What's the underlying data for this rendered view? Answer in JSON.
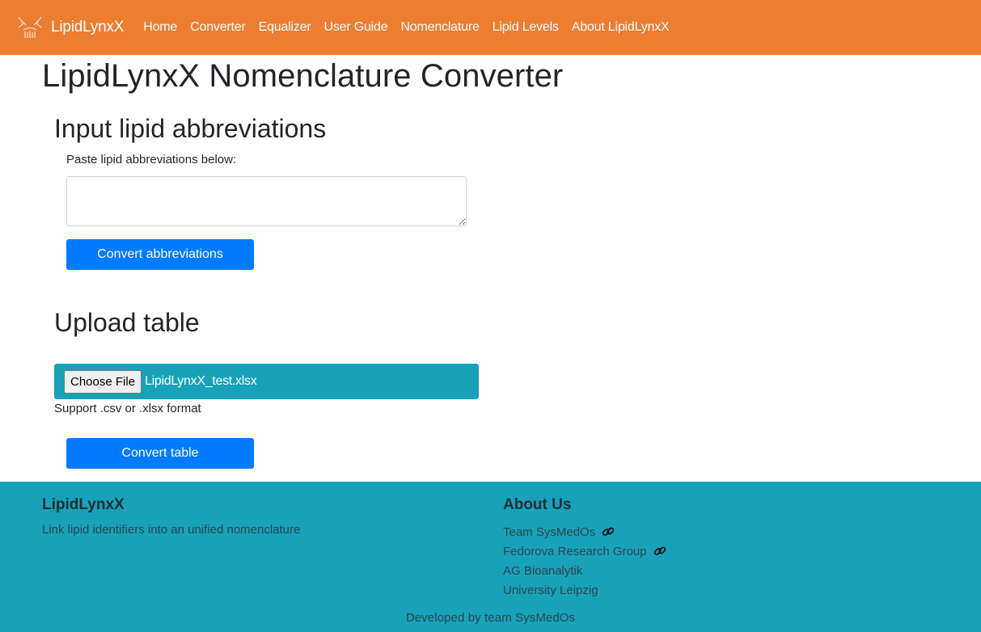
{
  "navbar": {
    "brand": "LipidLynxX",
    "links": [
      "Home",
      "Converter",
      "Equalizer",
      "User Guide",
      "Nomenclature",
      "Lipid Levels",
      "About LipidLynxX"
    ]
  },
  "main": {
    "title": "LipidLynxX Nomenclature Converter",
    "input_section": {
      "title": "Input lipid abbreviations",
      "label": "Paste lipid abbreviations below:",
      "textarea_value": "",
      "button": "Convert abbreviations"
    },
    "upload_section": {
      "title": "Upload table",
      "choose_button": "Choose File",
      "file_name": "LipidLynxX_test.xlsx",
      "hint": "Support .csv or .xlsx format",
      "button": "Convert table"
    }
  },
  "footer": {
    "brand": "LipidLynxX",
    "tagline": "Link lipid identifiers into an unified nomenclature",
    "about_title": "About Us",
    "about_items": [
      "Team SysMedOs",
      "Fedorova Research Group",
      "AG Bioanalytik",
      "University Leipzig"
    ],
    "credit": "Developed by team SysMedOs"
  },
  "colors": {
    "navbar": "#ed7d31",
    "primary_button": "#007bff",
    "teal": "#17a2b8"
  },
  "icons": {
    "brand": "lynx-logo-icon",
    "external_link": "link-icon"
  }
}
